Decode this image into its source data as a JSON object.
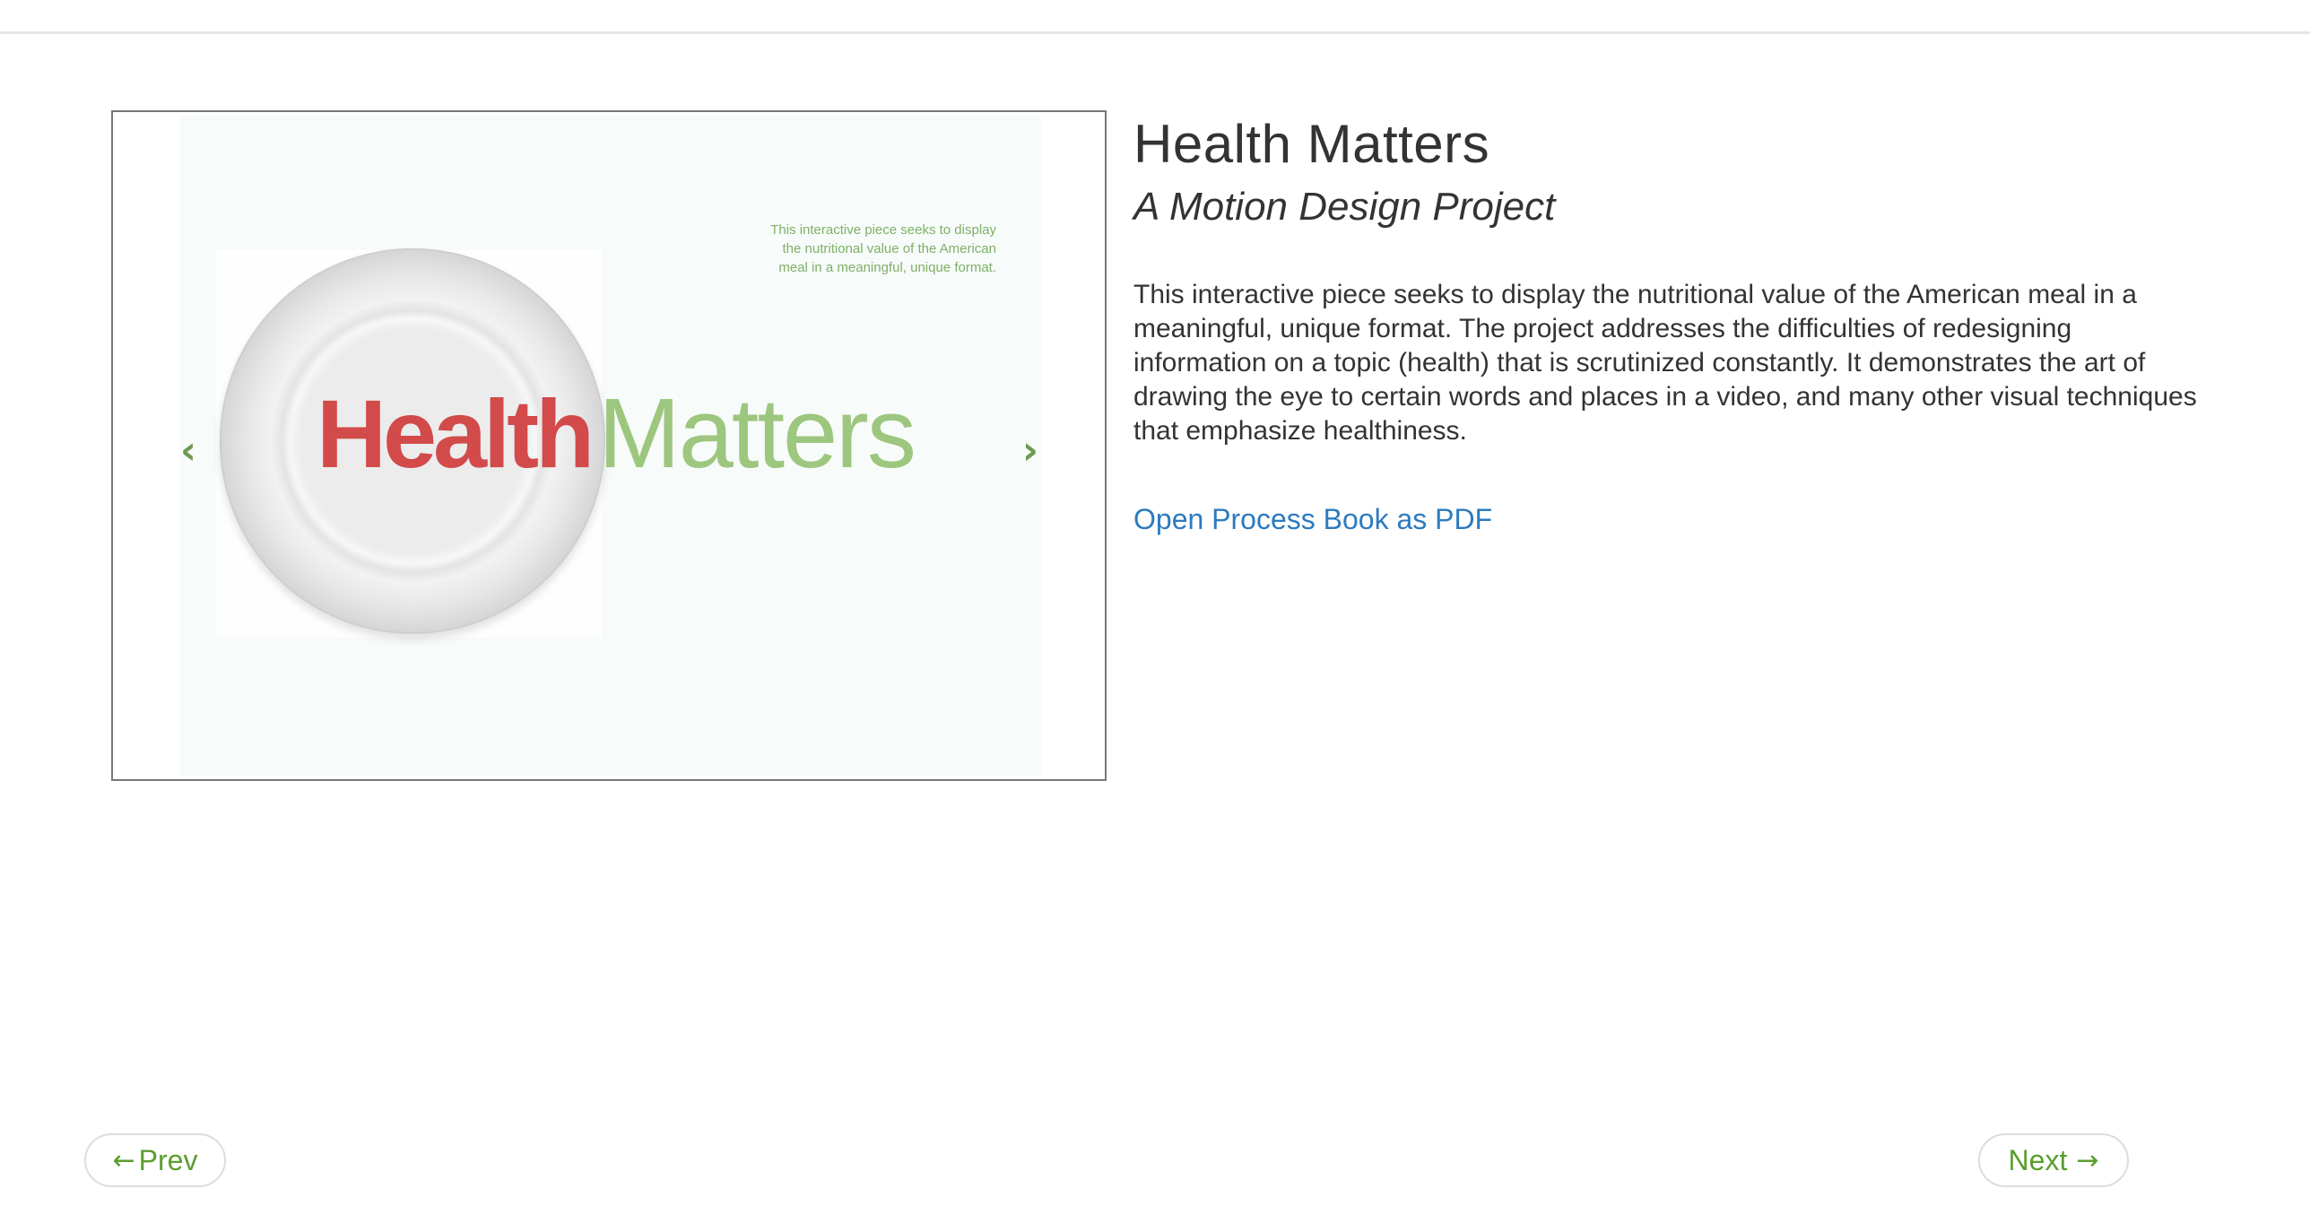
{
  "project": {
    "title": "Health Matters",
    "subtitle": "A Motion Design Project",
    "description": "This interactive piece seeks to display the nutritional value of the American meal in a meaningful, unique format. The project addresses the difficulties of redesigning information on a topic (health) that is scrutinized constantly. It demonstrates the art of drawing the eye to certain words and places in a video, and many other visual techniques that emphasize healthiness.",
    "pdf_link": "Open Process Book as PDF"
  },
  "slideshow": {
    "blurb": "This interactive piece seeks to display\nthe nutritional value of the American\nmeal in a meaningful, unique format.",
    "logo_word1": "Health",
    "logo_word2": "Matters",
    "prev_arrow": "‹",
    "next_arrow": "›"
  },
  "pager": {
    "prev_arrow": "←",
    "prev_label": "Prev",
    "next_label": "Next",
    "next_arrow": "→"
  },
  "colors": {
    "link": "#2c7bbf",
    "pager_text": "#5a9e2e",
    "logo_red": "#d24a4a",
    "logo_green": "#9dc67e"
  },
  "icons": {
    "slide_prev": "chevron-left-icon",
    "slide_next": "chevron-right-icon",
    "pager_prev": "arrow-left-icon",
    "pager_next": "arrow-right-icon"
  }
}
